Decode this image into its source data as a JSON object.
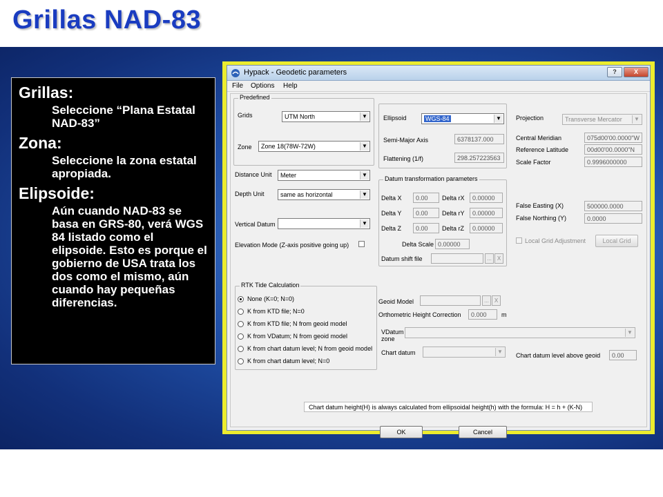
{
  "slide": {
    "title": "Grillas NAD-83",
    "sections": [
      {
        "heading": "Grillas:",
        "body": "Seleccione “Plana Estatal NAD-83”"
      },
      {
        "heading": "Zona:",
        "body": "Seleccione la zona estatal apropiada."
      },
      {
        "heading": "Elipsoide:",
        "body": "Aún cuando NAD-83 se basa en GRS-80, verá WGS 84 listado como el elipsoide. Esto es porque el gobierno de USA trata los dos como el mismo, aún cuando hay pequeñas diferencias."
      }
    ]
  },
  "dialog": {
    "title": "Hypack - Geodetic parameters",
    "help_btn": "?",
    "close_btn": "X",
    "menu": [
      "File",
      "Options",
      "Help"
    ],
    "predefined": {
      "group": "Predefined",
      "grids_label": "Grids",
      "grids_value": "UTM North",
      "zone_label": "Zone",
      "zone_value": "Zone 18(78W-72W)"
    },
    "ellipsoid": {
      "label": "Ellipsoid",
      "value": "WGS-84",
      "semi_major_label": "Semi-Major Axis",
      "semi_major_value": "6378137.000",
      "flattening_label": "Flattening (1/f)",
      "flattening_value": "298.257223563"
    },
    "projection": {
      "label": "Projection",
      "value": "Transverse Mercator",
      "central_meridian_label": "Central Meridian",
      "central_meridian_value": "075d00'00.0000\"W",
      "ref_latitude_label": "Reference Latitude",
      "ref_latitude_value": "00d00'00.0000\"N",
      "scale_factor_label": "Scale Factor",
      "scale_factor_value": "0.9996000000",
      "false_easting_label": "False Easting (X)",
      "false_easting_value": "500000.0000",
      "false_northing_label": "False Northing (Y)",
      "false_northing_value": "0.0000",
      "local_grid_checkbox": "Local Grid Adjustment",
      "local_grid_button": "Local Grid"
    },
    "units": {
      "distance_label": "Distance Unit",
      "distance_value": "Meter",
      "depth_label": "Depth Unit",
      "depth_value": "same as horizontal",
      "vertical_datum_label": "Vertical Datum",
      "vertical_datum_value": "",
      "elevation_mode_label": "Elevation Mode (Z-axis positive going up)"
    },
    "datum_transform": {
      "group": "Datum transformation parameters",
      "delta_x_label": "Delta X",
      "delta_x": "0.00",
      "delta_y_label": "Delta Y",
      "delta_y": "0.00",
      "delta_z_label": "Delta Z",
      "delta_z": "0.00",
      "delta_rx_label": "Delta rX",
      "delta_rx": "0.00000",
      "delta_ry_label": "Delta rY",
      "delta_ry": "0.00000",
      "delta_rz_label": "Delta rZ",
      "delta_rz": "0.00000",
      "delta_scale_label": "Delta Scale",
      "delta_scale": "0.00000",
      "shift_file_label": "Datum shift file",
      "shift_file_value": "",
      "browse": "...",
      "clear": "X"
    },
    "rtk": {
      "group": "RTK Tide Calculation",
      "options": [
        "None (K=0; N=0)",
        "K from KTD file; N=0",
        "K from KTD file; N from geoid model",
        "K from VDatum; N from geoid model",
        "K from chart datum level; N from geoid model",
        "K from chart datum level; N=0"
      ],
      "selected_index": 0
    },
    "geoid": {
      "model_label": "Geoid Model",
      "model_value": "",
      "browse": "...",
      "clear": "X",
      "ortho_label": "Orthometric Height Correction",
      "ortho_value": "0.000",
      "ortho_unit": "m",
      "vdatum_zone_label": "VDatum zone",
      "vdatum_zone_value": "",
      "chart_datum_label": "Chart datum",
      "chart_datum_value": "",
      "chart_level_label": "Chart datum level above geoid",
      "chart_level_value": "0.00"
    },
    "note": "Chart datum height(H) is always calculated from ellipsoidal height(h) with the formula: H = h + (K-N)",
    "ok": "OK",
    "cancel": "Cancel"
  },
  "colors": {
    "title": "#1a3cc0",
    "background_dark": "#12307a",
    "background_light": "#4a86d6",
    "dialog_frame": "#ecec2e",
    "selection": "#3366cc"
  }
}
